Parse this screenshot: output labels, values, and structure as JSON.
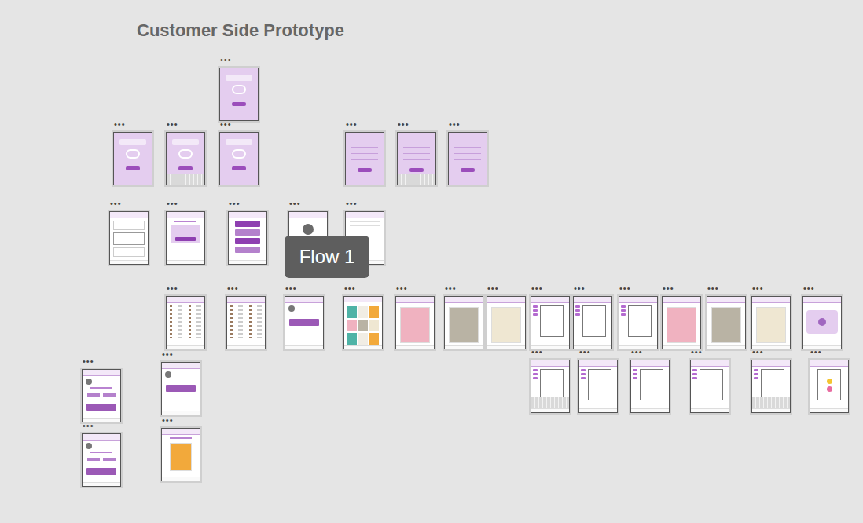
{
  "page": {
    "title": "Customer Side Prototype"
  },
  "tooltip": {
    "label": "Flow 1"
  },
  "frames": [
    {
      "kind": "logo",
      "menu": "•••"
    },
    {
      "kind": "logo",
      "menu": "•••"
    },
    {
      "kind": "logo-keyboard",
      "menu": "•••"
    },
    {
      "kind": "logo",
      "menu": "•••"
    },
    {
      "kind": "form",
      "menu": "•••"
    },
    {
      "kind": "form-keyboard",
      "menu": "•••"
    },
    {
      "kind": "form",
      "menu": "•••"
    },
    {
      "kind": "signature",
      "menu": "•••"
    },
    {
      "kind": "welcome",
      "menu": "•••"
    },
    {
      "kind": "menu",
      "menu": "•••"
    },
    {
      "kind": "help",
      "menu": "•••"
    },
    {
      "kind": "blank",
      "menu": "•••"
    },
    {
      "kind": "list",
      "menu": "•••"
    },
    {
      "kind": "list",
      "menu": "•••"
    },
    {
      "kind": "profile",
      "menu": "•••"
    },
    {
      "kind": "grid",
      "menu": "•••"
    },
    {
      "kind": "card",
      "menu": "•••"
    },
    {
      "kind": "card",
      "menu": "•••"
    },
    {
      "kind": "card",
      "menu": "•••"
    },
    {
      "kind": "editor",
      "menu": "•••"
    },
    {
      "kind": "editor",
      "menu": "•••"
    },
    {
      "kind": "editor",
      "menu": "•••"
    },
    {
      "kind": "card",
      "menu": "•••"
    },
    {
      "kind": "card",
      "menu": "•••"
    },
    {
      "kind": "card",
      "menu": "•••"
    },
    {
      "kind": "confirm",
      "menu": "•••"
    },
    {
      "kind": "editor-keyboard",
      "menu": "•••"
    },
    {
      "kind": "editor",
      "menu": "•••"
    },
    {
      "kind": "editor",
      "menu": "•••"
    },
    {
      "kind": "editor",
      "menu": "•••"
    },
    {
      "kind": "editor-keyboard",
      "menu": "•••"
    },
    {
      "kind": "emoji",
      "menu": "•••"
    },
    {
      "kind": "boost",
      "menu": "•••"
    },
    {
      "kind": "boost",
      "menu": "•••"
    },
    {
      "kind": "profile",
      "menu": "•••"
    },
    {
      "kind": "thanks",
      "menu": "•••"
    }
  ]
}
